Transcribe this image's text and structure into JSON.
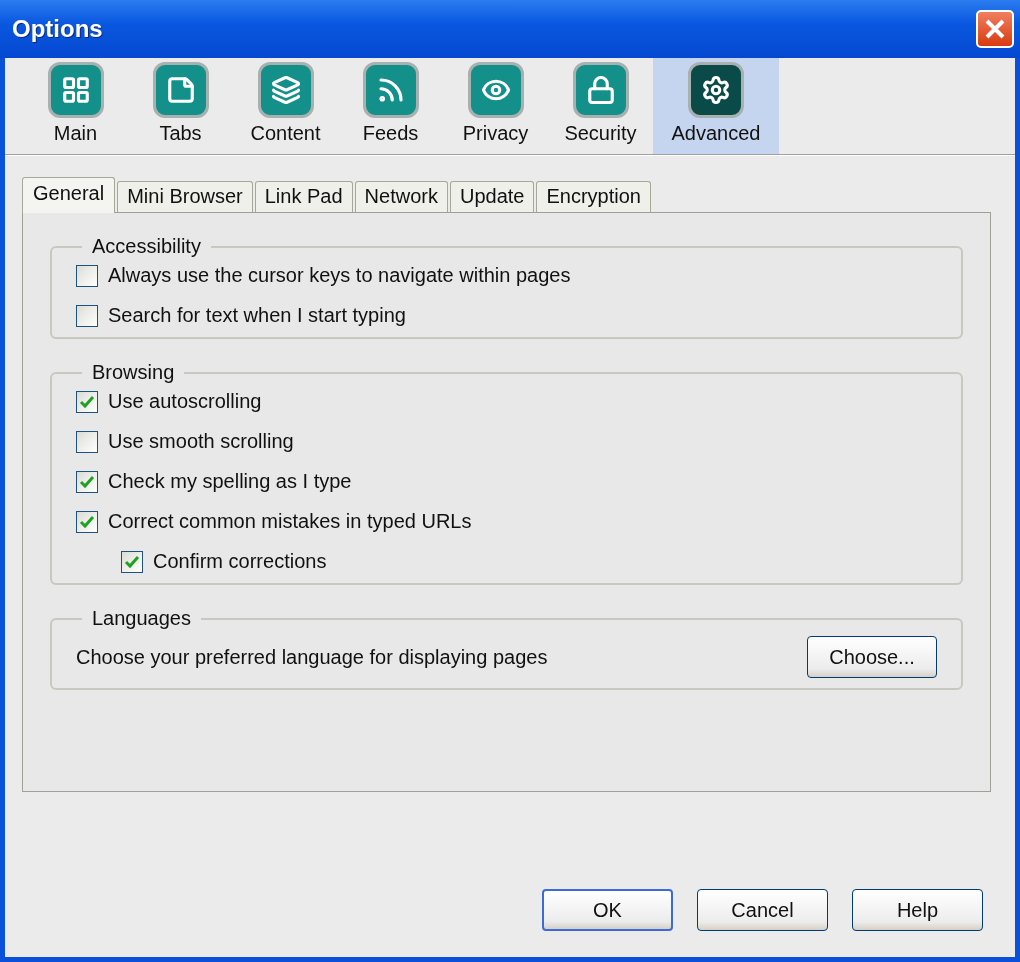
{
  "window": {
    "title": "Options"
  },
  "toolbar": [
    {
      "label": "Main",
      "selected": false
    },
    {
      "label": "Tabs",
      "selected": false
    },
    {
      "label": "Content",
      "selected": false
    },
    {
      "label": "Feeds",
      "selected": false
    },
    {
      "label": "Privacy",
      "selected": false
    },
    {
      "label": "Security",
      "selected": false
    },
    {
      "label": "Advanced",
      "selected": true
    }
  ],
  "tabs": [
    {
      "label": "General",
      "selected": true
    },
    {
      "label": "Mini Browser",
      "selected": false
    },
    {
      "label": "Link Pad",
      "selected": false
    },
    {
      "label": "Network",
      "selected": false
    },
    {
      "label": "Update",
      "selected": false
    },
    {
      "label": "Encryption",
      "selected": false
    }
  ],
  "groups": [
    {
      "title": "Accessibility",
      "items": [
        {
          "label": "Always use the cursor keys to navigate within pages",
          "checked": false
        },
        {
          "label": "Search for text when I start typing",
          "checked": false
        }
      ]
    },
    {
      "title": "Browsing",
      "items": [
        {
          "label": "Use autoscrolling",
          "checked": true
        },
        {
          "label": "Use smooth scrolling",
          "checked": false
        },
        {
          "label": "Check my spelling as I type",
          "checked": true
        },
        {
          "label": "Correct common mistakes in typed URLs",
          "checked": true,
          "children": [
            {
              "label": "Confirm corrections",
              "checked": true
            }
          ]
        }
      ]
    }
  ],
  "languages": {
    "title": "Languages",
    "text": "Choose your preferred language for displaying pages",
    "button": "Choose..."
  },
  "buttons": [
    {
      "label": "OK",
      "default": true
    },
    {
      "label": "Cancel",
      "default": false
    },
    {
      "label": "Help",
      "default": false
    }
  ]
}
